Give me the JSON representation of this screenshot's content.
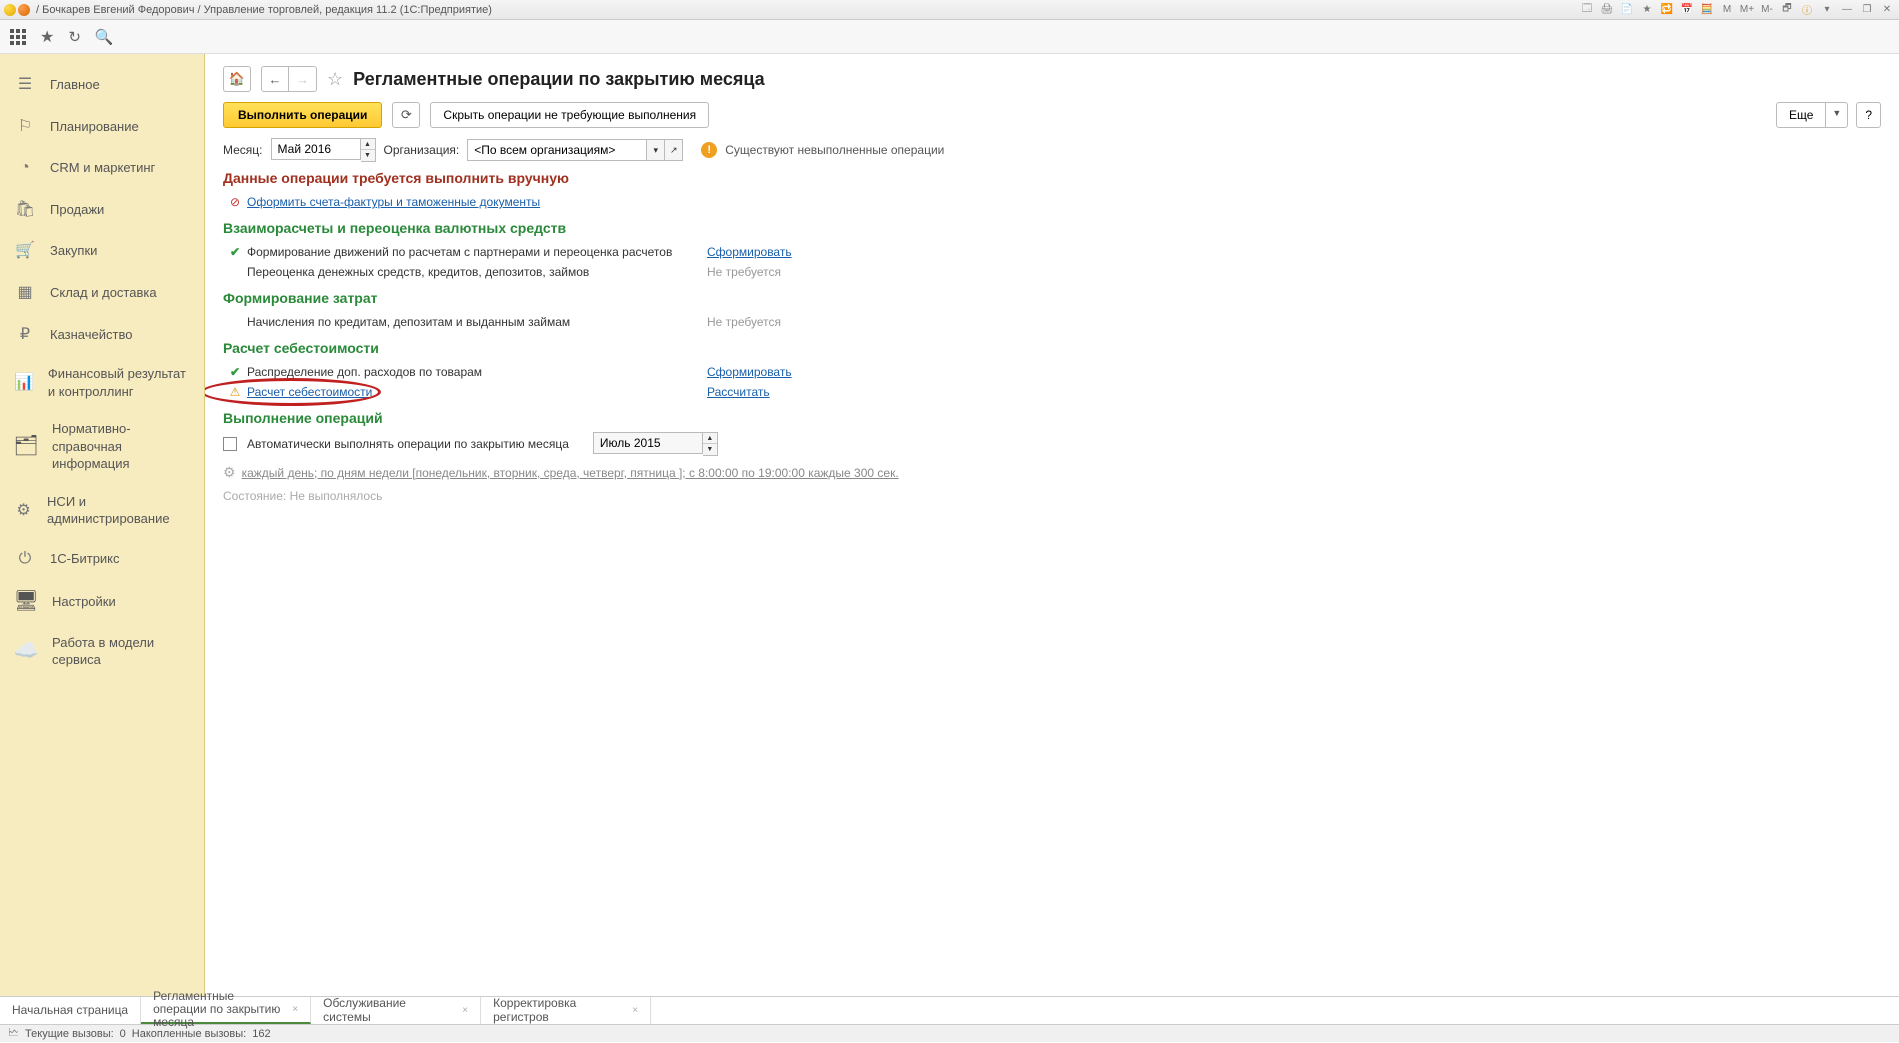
{
  "titlebar": {
    "text": " / Бочкарев Евгений Федорович / Управление торговлей, редакция 11.2  (1С:Предприятие)",
    "right_letters": [
      "M",
      "M+",
      "M-"
    ]
  },
  "sidebar": {
    "items": [
      {
        "label": "Главное"
      },
      {
        "label": "Планирование"
      },
      {
        "label": "CRM и маркетинг"
      },
      {
        "label": "Продажи"
      },
      {
        "label": "Закупки"
      },
      {
        "label": "Склад и доставка"
      },
      {
        "label": "Казначейство"
      },
      {
        "label": "Финансовый результат и контроллинг"
      },
      {
        "label": "Нормативно-справочная информация"
      },
      {
        "label": "НСИ и администрирование"
      },
      {
        "label": "1С-Битрикс"
      },
      {
        "label": "Настройки"
      },
      {
        "label": "Работа в модели сервиса"
      }
    ]
  },
  "header": {
    "title": "Регламентные операции по закрытию месяца"
  },
  "commands": {
    "run": "Выполнить операции",
    "hide": "Скрыть операции не требующие выполнения",
    "more": "Еще",
    "help": "?"
  },
  "filters": {
    "month_label": "Месяц:",
    "month_value": "Май 2016",
    "org_label": "Организация:",
    "org_value": "<По всем организациям>",
    "status": "Существуют невыполненные операции"
  },
  "sections": {
    "manual": {
      "title": "Данные операции требуется выполнить вручную",
      "link": "Оформить счета-фактуры и таможенные документы"
    },
    "mutual": {
      "title": "Взаиморасчеты и переоценка валютных средств",
      "r1": {
        "name": "Формирование движений по расчетам с партнерами и переоценка расчетов",
        "action": "Сформировать"
      },
      "r2": {
        "name": "Переоценка денежных средств, кредитов, депозитов, займов",
        "status": "Не требуется"
      }
    },
    "costs": {
      "title": "Формирование затрат",
      "r1": {
        "name": "Начисления по кредитам, депозитам и выданным займам",
        "status": "Не требуется"
      }
    },
    "selfcost": {
      "title": "Расчет себестоимости",
      "r1": {
        "name": "Распределение доп. расходов по товарам",
        "action": "Сформировать"
      },
      "r2": {
        "name": "Расчет себестоимости",
        "action": "Рассчитать"
      }
    },
    "exec": {
      "title": "Выполнение операций",
      "auto_label": "Автоматически выполнять операции по закрытию месяца",
      "auto_month": "Июль 2015",
      "schedule": "каждый  день; по дням недели [понедельник, вторник, среда, четверг, пятница ]; с 8:00:00 по 19:00:00 каждые 300 сек.",
      "state_label": "Состояние:",
      "state_value": "Не выполнялось"
    }
  },
  "tabs": [
    {
      "label": "Начальная страница",
      "closable": false
    },
    {
      "label": "Регламентные операции по закрытию месяца",
      "closable": true,
      "active": true
    },
    {
      "label": "Обслуживание системы",
      "closable": true
    },
    {
      "label": "Корректировка регистров",
      "closable": true
    }
  ],
  "statusbar": {
    "current_label": "Текущие вызовы:",
    "current_value": "0",
    "accum_label": "Накопленные вызовы:",
    "accum_value": "162"
  }
}
